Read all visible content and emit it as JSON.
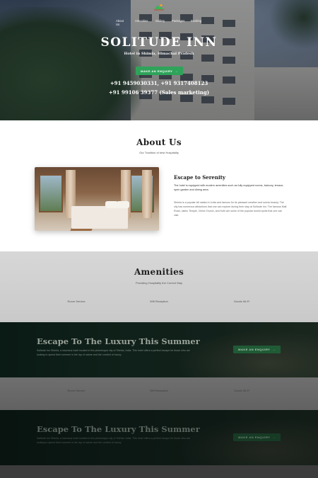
{
  "nav": {
    "items": [
      "About Us",
      "Amenities",
      "Gallery",
      "Packages",
      "Booking"
    ]
  },
  "hero": {
    "title": "SOLITUDE INN",
    "subtitle": "Hotel in Shimla, Himachal Pradesh",
    "button_label": "MAKE AN ENQUIRY",
    "phones_line1": "+91 9459030331,   +91 9317408123",
    "phones_line2": "+91 99106 39377 (Sales marketing)"
  },
  "about": {
    "title": "About Us",
    "subtitle": "Our Tradition of best Hospitality",
    "heading": "Escape to Serenity",
    "para1": "The hotel is equipped with modern amenities such as fully equipped rooms, balcony, terrace, open garden and dining area.",
    "para2": "Shimla is a popular hill station in India and famous for its pleasant weather and scenic beauty. The city has numerous attractions that one can explore during their stay at Solitude Inn. The famous Mall Road, Jakhu Temple, Christ Church, and Kufri are some of the popular tourist spots that one can visit."
  },
  "amenities": {
    "title": "Amenities",
    "subtitle": "Providing Hospitality the Correct Way",
    "items": [
      "Room Service",
      "Wifi Reception",
      "Goods Wi-Fi"
    ]
  },
  "banner": {
    "title": "Escape To The Luxury This Summer",
    "text": "Solitude Inn Shimla, a luxurious hotel located in the picturesque city of Shimla, India. This hotel offers a perfect escape for those who are looking to spend their summer in the lap of nature and the comfort of luxury.",
    "button_label": "MAKE AN ENQUIRY"
  },
  "amenities_repeat": {
    "items": [
      "Room Service",
      "Wifi Reception",
      "Goods Wi-Fi"
    ]
  },
  "banner_repeat": {
    "title": "Escape To The Luxury This Summer",
    "text": "Solitude Inn Shimla, a luxurious hotel located in the picturesque city of Shimla, India. This hotel offers a perfect escape for those who are looking to spend their summer in the lap of nature and the comfort of luxury.",
    "button_label": "MAKE AN ENQUIRY"
  },
  "colors": {
    "accent_green": "#2fa35a",
    "dark_green": "#1f5b35"
  }
}
